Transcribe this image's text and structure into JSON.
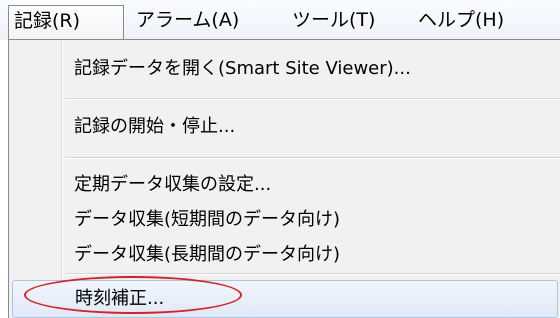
{
  "menubar": {
    "items": [
      {
        "label": "記録(R)"
      },
      {
        "label": "アラーム(A)"
      },
      {
        "label": "ツール(T)"
      },
      {
        "label": "ヘルプ(H)"
      }
    ]
  },
  "dropdown": {
    "items": [
      {
        "label": "記録データを開く(Smart Site Viewer)..."
      },
      {
        "label": "記録の開始・停止..."
      },
      {
        "label": "定期データ収集の設定..."
      },
      {
        "label": "データ収集(短期間のデータ向け)"
      },
      {
        "label": "データ収集(長期間のデータ向け)"
      },
      {
        "label": "時刻補正..."
      }
    ]
  },
  "colors": {
    "annotation": "#e02020",
    "highlight_border": "#a9c6ea",
    "menu_background": "#f1f1f1"
  }
}
